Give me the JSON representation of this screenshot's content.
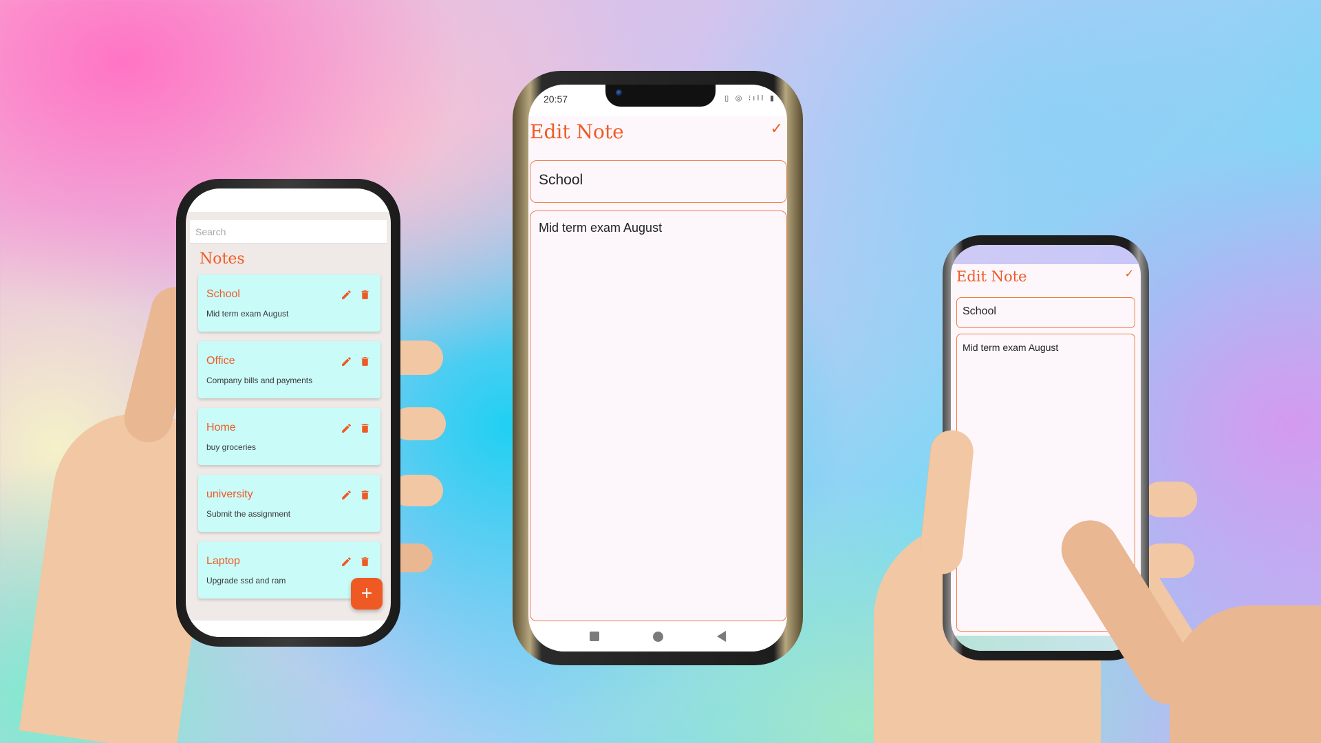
{
  "notes_list": {
    "search_placeholder": "Search",
    "heading": "Notes",
    "items": [
      {
        "title": "School",
        "description": "Mid term exam August"
      },
      {
        "title": "Office",
        "description": "Company bills and payments"
      },
      {
        "title": "Home",
        "description": "buy groceries"
      },
      {
        "title": "university",
        "description": "Submit the assignment"
      },
      {
        "title": "Laptop",
        "description": "Upgrade ssd and ram"
      }
    ],
    "add_button_label": "+",
    "icons": {
      "edit": "pencil-icon",
      "delete": "trash-icon"
    }
  },
  "edit_note": {
    "status_time": "20:57",
    "status_icons": "▯ ◎ ⁝ıll ▮",
    "heading": "Edit Note",
    "save_icon": "✓",
    "title_value": "School",
    "body_value": "Mid term exam August"
  },
  "edit_note_small": {
    "heading": "Edit Note",
    "save_icon": "✓",
    "title_value": "School",
    "body_value": "Mid term exam August"
  },
  "colors": {
    "accent": "#ef5a24",
    "card_background": "#c9fbf8",
    "list_background": "#efeae7",
    "editor_background": "#fdf7fb"
  }
}
